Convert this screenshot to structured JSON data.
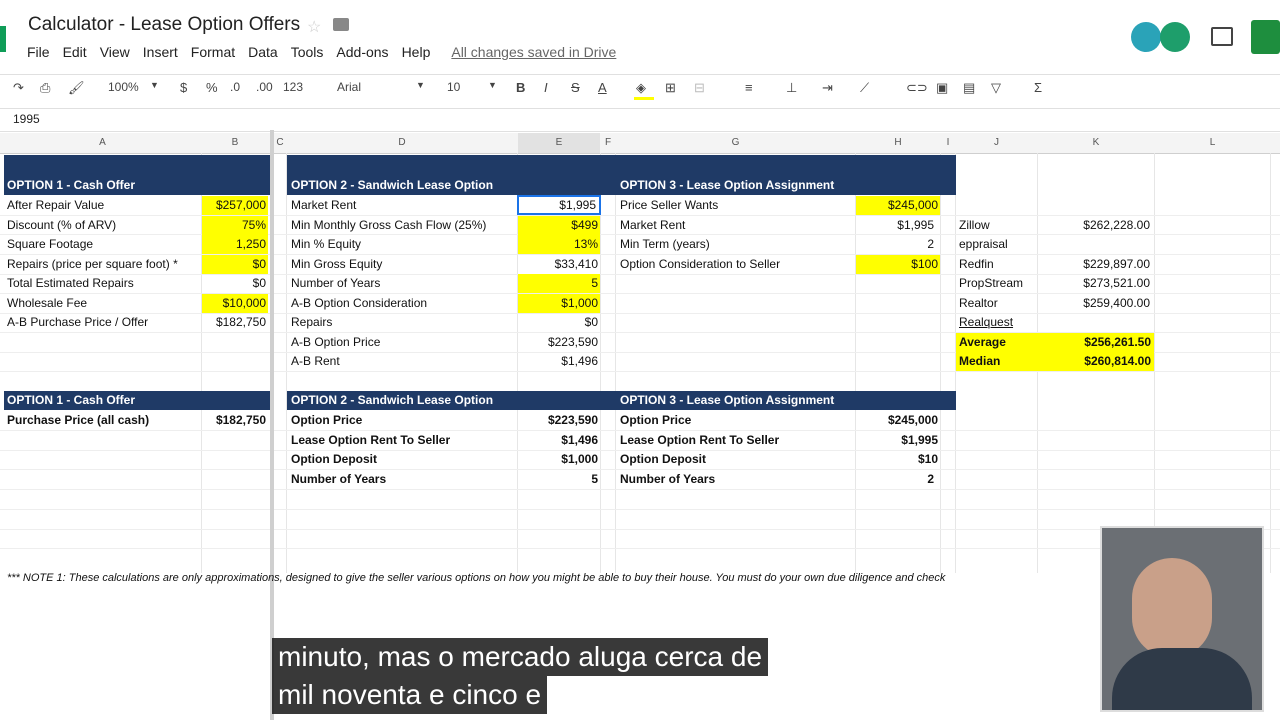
{
  "app": {
    "title": "Calculator - Lease Option Offers",
    "menu": [
      "File",
      "Edit",
      "View",
      "Insert",
      "Format",
      "Data",
      "Tools",
      "Add-ons",
      "Help"
    ],
    "saved_status": "All changes saved in Drive"
  },
  "toolbar": {
    "zoom": "100%",
    "currency": "$",
    "percent": "%",
    "dec_decrease": ".0",
    "dec_increase": ".00",
    "more_formats": "123",
    "font": "Arial",
    "font_size": "10",
    "bold": "B",
    "italic": "I",
    "strike": "S",
    "text_color": "A"
  },
  "formula_bar": {
    "value": "1995"
  },
  "columns": [
    "A",
    "B",
    "C",
    "D",
    "E",
    "F",
    "G",
    "H",
    "I",
    "J",
    "K",
    "L"
  ],
  "option1": {
    "header": "OPTION 1 - Cash Offer",
    "rows": [
      {
        "label": "After Repair Value",
        "value": "$257,000",
        "highlight": true
      },
      {
        "label": "Discount (% of ARV)",
        "value": "75%",
        "highlight": true
      },
      {
        "label": "Square Footage",
        "value": "1,250",
        "highlight": true
      },
      {
        "label": "Repairs (price per square foot) *",
        "value": "$0",
        "highlight": true
      },
      {
        "label": "Total Estimated Repairs",
        "value": "$0",
        "highlight": false
      },
      {
        "label": "Wholesale Fee",
        "value": "$10,000",
        "highlight": true
      },
      {
        "label": "A-B Purchase Price / Offer",
        "value": "$182,750",
        "highlight": false
      }
    ],
    "summary_header": "OPTION 1 - Cash Offer",
    "summary": [
      {
        "label": "Purchase Price (all cash)",
        "value": "$182,750"
      }
    ]
  },
  "option2": {
    "header": "OPTION 2 - Sandwich Lease Option",
    "rows": [
      {
        "label": "Market Rent",
        "value": "$1,995",
        "highlight": false
      },
      {
        "label": "Min Monthly Gross Cash Flow (25%)",
        "value": "$499",
        "highlight": true
      },
      {
        "label": "Min % Equity",
        "value": "13%",
        "highlight": true
      },
      {
        "label": "Min Gross Equity",
        "value": "$33,410",
        "highlight": false
      },
      {
        "label": "Number of Years",
        "value": "5",
        "highlight": true
      },
      {
        "label": "A-B Option Consideration",
        "value": "$1,000",
        "highlight": true
      },
      {
        "label": "Repairs",
        "value": "$0",
        "highlight": false
      },
      {
        "label": "A-B Option Price",
        "value": "$223,590",
        "highlight": false
      },
      {
        "label": "A-B Rent",
        "value": "$1,496",
        "highlight": false
      }
    ],
    "summary_header": "OPTION 2 - Sandwich Lease Option",
    "summary": [
      {
        "label": "Option Price",
        "value": "$223,590"
      },
      {
        "label": "Lease Option Rent To Seller",
        "value": "$1,496"
      },
      {
        "label": "Option Deposit",
        "value": "$1,000"
      },
      {
        "label": "Number of Years",
        "value": "5"
      }
    ]
  },
  "option3": {
    "header": "OPTION 3 - Lease Option Assignment",
    "rows": [
      {
        "label": "Price Seller Wants",
        "value": "$245,000",
        "highlight": true
      },
      {
        "label": "Market Rent",
        "value": "$1,995",
        "highlight": false
      },
      {
        "label": "Min Term (years)",
        "value": "2",
        "highlight": false
      },
      {
        "label": "Option Consideration to Seller",
        "value": "$100",
        "highlight": true
      }
    ],
    "summary_header": "OPTION 3 - Lease Option Assignment",
    "summary": [
      {
        "label": "Option Price",
        "value": "$245,000"
      },
      {
        "label": "Lease Option Rent To Seller",
        "value": "$1,995"
      },
      {
        "label": "Option Deposit",
        "value": "$10"
      },
      {
        "label": "Number of Years",
        "value": "2"
      }
    ]
  },
  "valuations": [
    {
      "label": "Zillow",
      "value": "$262,228.00"
    },
    {
      "label": "eppraisal",
      "value": ""
    },
    {
      "label": "Redfin",
      "value": "$229,897.00"
    },
    {
      "label": "PropStream",
      "value": "$273,521.00"
    },
    {
      "label": "Realtor",
      "value": "$259,400.00"
    },
    {
      "label": "Realquest",
      "value": ""
    },
    {
      "label": "Average",
      "value": "$256,261.50"
    },
    {
      "label": "Median",
      "value": "$260,814.00"
    }
  ],
  "note": "*** NOTE 1: These calculations are only approximations, designed to give the seller various options on how you might be able to buy their house.  You must do your own due diligence and check",
  "subtitles": [
    "minuto, mas o mercado aluga cerca de",
    "mil noventa e cinco e"
  ],
  "colors": {
    "header_band": "#1f3a66",
    "highlight": "#ffff00"
  }
}
